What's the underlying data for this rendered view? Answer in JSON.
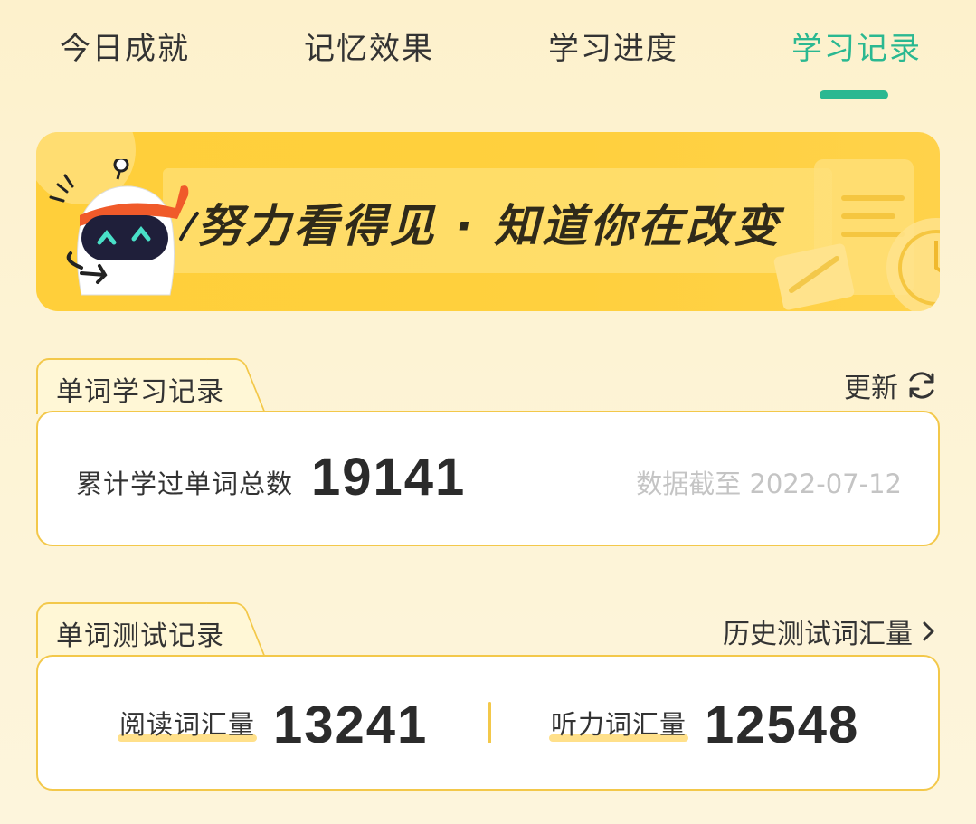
{
  "tabs": [
    {
      "label": "今日成就",
      "active": false
    },
    {
      "label": "记忆效果",
      "active": false
    },
    {
      "label": "学习进度",
      "active": false
    },
    {
      "label": "学习记录",
      "active": true
    }
  ],
  "colors": {
    "accent": "#2ab891",
    "banner": "#ffcf3a",
    "card_border": "#f3c84a"
  },
  "banner": {
    "slogan": "努力看得见 · 知道你在改变",
    "mascot_icon": "robot-mascot-icon"
  },
  "word_study": {
    "title": "单词学习记录",
    "action_label": "更新",
    "action_icon": "refresh-icon",
    "total_label": "累计学过单词总数",
    "total_value": "19141",
    "date_note": "数据截至 2022-07-12"
  },
  "word_test": {
    "title": "单词测试记录",
    "action_label": "历史测试词汇量",
    "action_icon": "chevron-right-icon",
    "reading_label": "阅读词汇量",
    "reading_value": "13241",
    "listening_label": "听力词汇量",
    "listening_value": "12548"
  }
}
